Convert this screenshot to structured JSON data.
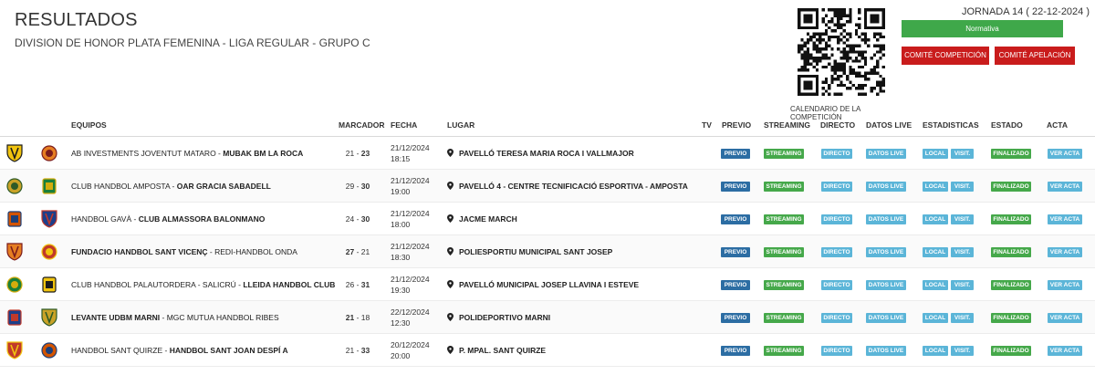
{
  "header": {
    "title": "RESULTADOS",
    "subtitle": "DIVISION DE HONOR PLATA FEMENINA - LIGA REGULAR - GRUPO C",
    "jornada": "JORNADA 14 ( 22-12-2024 )",
    "normativa_label": "Normativa",
    "comite_competicion_label": "COMITÉ COMPETICIÓN",
    "comite_apelacion_label": "COMITÉ APELACIÓN",
    "qr_caption": "CALENDARIO DE LA COMPETICIÓN"
  },
  "table": {
    "headers": {
      "equipos": "EQUIPOS",
      "marcador": "MARCADOR",
      "fecha": "FECHA",
      "lugar": "LUGAR",
      "tv": "TV",
      "previo": "PREVIO",
      "streaming": "STREAMING",
      "directo": "DIRECTO",
      "datos_live": "DATOS LIVE",
      "estadisticas": "ESTADISTICAS",
      "estado": "ESTADO",
      "acta": "ACTA"
    },
    "buttons": {
      "previo": "PREVIO",
      "streaming": "STREAMING",
      "directo": "DIRECTO",
      "datos_live": "DATOS LIVE",
      "local": "LOCAL",
      "visit": "VISIT.",
      "estado": "FINALIZADO",
      "acta": "VER ACTA"
    },
    "rows": [
      {
        "home": "AB INVESTMENTS JOVENTUT MATARO",
        "away": "MUBAK BM LA ROCA",
        "winner": "away",
        "score_home": "21",
        "score_away": "23",
        "date": "21/12/2024",
        "time": "18:15",
        "venue": "PAVELLÓ TERESA MARIA ROCA I VALLMAJOR"
      },
      {
        "home": "CLUB HANDBOL AMPOSTA",
        "away": "OAR GRACIA SABADELL",
        "winner": "away",
        "score_home": "29",
        "score_away": "30",
        "date": "21/12/2024",
        "time": "19:00",
        "venue": "PAVELLÓ 4 - CENTRE TECNIFICACIÓ ESPORTIVA - AMPOSTA"
      },
      {
        "home": "HANDBOL GAVÀ",
        "away": "CLUB ALMASSORA BALONMANO",
        "winner": "away",
        "score_home": "24",
        "score_away": "30",
        "date": "21/12/2024",
        "time": "18:00",
        "venue": "JACME MARCH"
      },
      {
        "home": "FUNDACIO HANDBOL SANT VICENÇ",
        "away": "REDI-HANDBOL ONDA",
        "winner": "home",
        "score_home": "27",
        "score_away": "21",
        "date": "21/12/2024",
        "time": "18:30",
        "venue": "POLIESPORTIU MUNICIPAL SANT JOSEP"
      },
      {
        "home": "CLUB HANDBOL PALAUTORDERA - SALICRÚ",
        "away": "LLEIDA HANDBOL CLUB",
        "winner": "away",
        "score_home": "26",
        "score_away": "31",
        "date": "21/12/2024",
        "time": "19:30",
        "venue": "PAVELLÓ MUNICIPAL JOSEP LLAVINA I ESTEVE"
      },
      {
        "home": "LEVANTE UDBM MARNI",
        "away": "MGC MUTUA HANDBOL RIBES",
        "winner": "home",
        "score_home": "21",
        "score_away": "18",
        "date": "22/12/2024",
        "time": "12:30",
        "venue": "POLIDEPORTIVO MARNI"
      },
      {
        "home": "HANDBOL SANT QUIRZE",
        "away": "HANDBOL SANT JOAN DESPÍ A",
        "winner": "away",
        "score_home": "21",
        "score_away": "33",
        "date": "20/12/2024",
        "time": "20:00",
        "venue": "P. MPAL. SANT QUIRZE"
      }
    ]
  },
  "colors": {
    "green": "#45a84a",
    "red": "#c91c1c",
    "blue_dark": "#2c6da3",
    "blue_light": "#5bb5d8"
  },
  "icons": {
    "venue": "map-pin-icon",
    "team_logo": "club-crest-icon",
    "qr": "qr-code-icon"
  }
}
